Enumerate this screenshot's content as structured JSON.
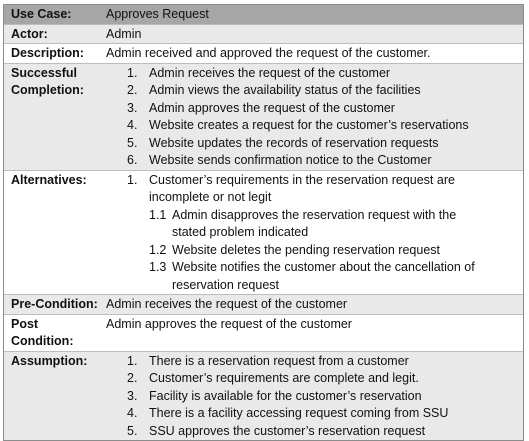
{
  "use_case": {
    "label": "Use Case:",
    "value": "Approves Request"
  },
  "actor": {
    "label": "Actor:",
    "value": "Admin"
  },
  "description": {
    "label": "Description:",
    "value": "Admin received and approved the request of the customer."
  },
  "successful_completion": {
    "label_line1": "Successful",
    "label_line2": "Completion:",
    "steps": [
      {
        "num": "1.",
        "text": "Admin receives the request of the customer"
      },
      {
        "num": "2.",
        "text": "Admin views the availability status of the facilities"
      },
      {
        "num": "3.",
        "text": "Admin approves the request of the customer"
      },
      {
        "num": "4.",
        "text": "Website creates a request for the customer’s reservations"
      },
      {
        "num": "5.",
        "text": "Website updates the records of reservation requests"
      },
      {
        "num": "6.",
        "text": "Website sends confirmation notice to the Customer"
      }
    ]
  },
  "alternatives": {
    "label": "Alternatives:",
    "main": {
      "num": "1.",
      "line1": "Customer’s requirements in the reservation request are",
      "line2": "incomplete or not legit"
    },
    "subs": [
      {
        "num": "1.1",
        "line1": "Admin disapproves the reservation request with the",
        "line2": "stated problem indicated"
      },
      {
        "num": "1.2",
        "line1": "Website deletes the pending reservation request",
        "line2": ""
      },
      {
        "num": "1.3",
        "line1": "Website notifies the customer about the cancellation of",
        "line2": "reservation request"
      }
    ]
  },
  "pre_condition": {
    "label": "Pre-Condition:",
    "value": "Admin receives the request of the customer"
  },
  "post_condition": {
    "label_line1": "Post",
    "label_line2": "Condition:",
    "value": "Admin approves the request of the customer"
  },
  "assumption": {
    "label": "Assumption:",
    "items": [
      {
        "num": "1.",
        "text": "There is a reservation request from a customer"
      },
      {
        "num": "2.",
        "text": "Customer’s requirements are complete and legit."
      },
      {
        "num": "3.",
        "text": "Facility is available for the customer’s reservation"
      },
      {
        "num": "4.",
        "text": "There is a facility accessing request coming from SSU"
      },
      {
        "num": "5.",
        "text": "SSU approves the customer’s reservation request"
      }
    ]
  }
}
